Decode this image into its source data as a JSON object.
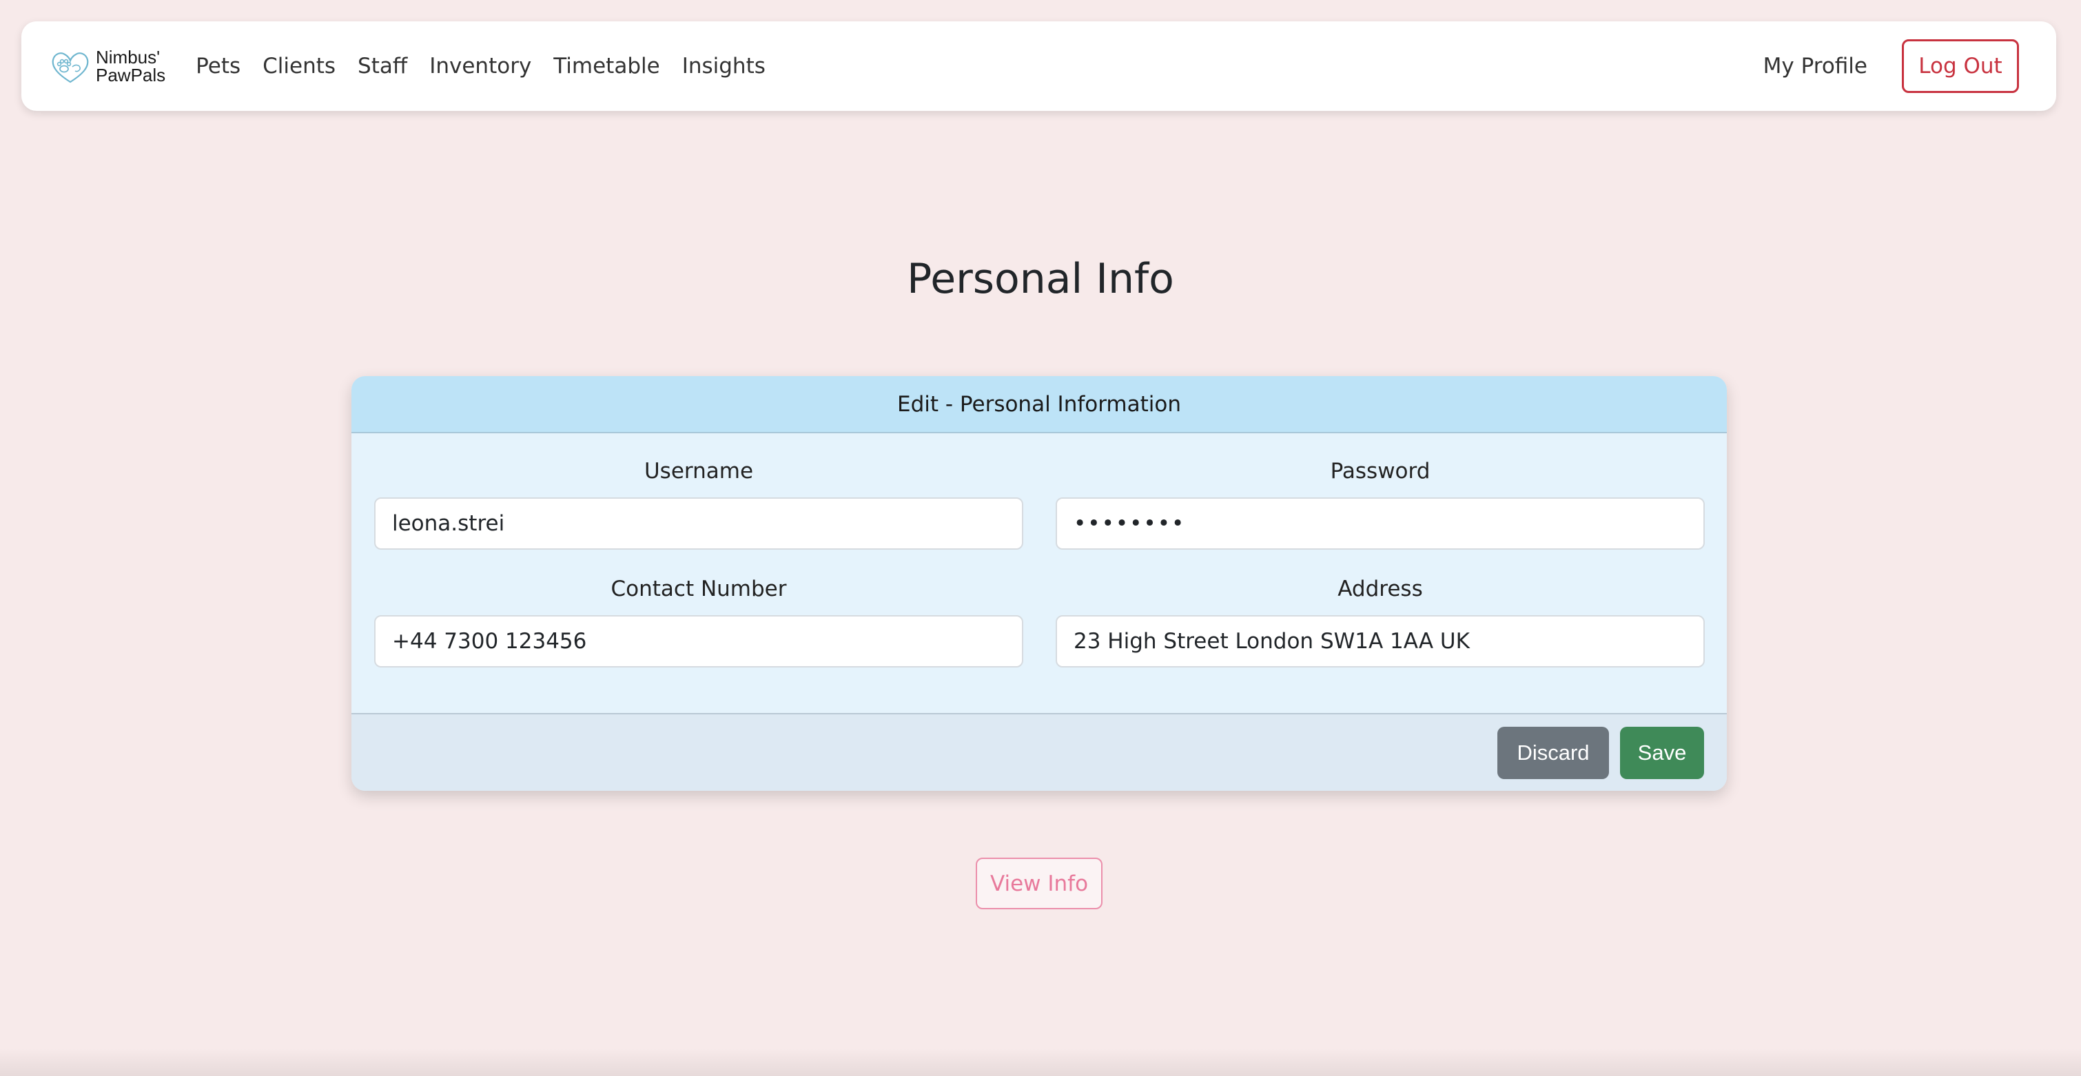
{
  "brand": {
    "line1": "Nimbus'",
    "line2": "PawPals",
    "logo_icon": "paw-heart-logo-icon"
  },
  "nav": {
    "items": [
      {
        "label": "Pets"
      },
      {
        "label": "Clients"
      },
      {
        "label": "Staff"
      },
      {
        "label": "Inventory"
      },
      {
        "label": "Timetable"
      },
      {
        "label": "Insights"
      }
    ],
    "my_profile": "My Profile",
    "logout": "Log Out"
  },
  "page": {
    "title": "Personal Info"
  },
  "card": {
    "header": "Edit - Personal Information",
    "fields": {
      "username": {
        "label": "Username",
        "value": "leona.strei"
      },
      "password": {
        "label": "Password",
        "value": "••••••••"
      },
      "contact": {
        "label": "Contact Number",
        "value": "+44 7300 123456"
      },
      "address": {
        "label": "Address",
        "value": "23 High Street London SW1A 1AA UK"
      }
    },
    "discard_label": "Discard",
    "save_label": "Save"
  },
  "view_info_label": "View Info",
  "colors": {
    "page_bg": "#f7eaea",
    "card_header_bg": "#bde3f7",
    "card_body_bg": "#e5f3fc",
    "logout": "#c8323f",
    "discard": "#6c757d",
    "save": "#3f8a58",
    "view_info": "#e8799b"
  }
}
